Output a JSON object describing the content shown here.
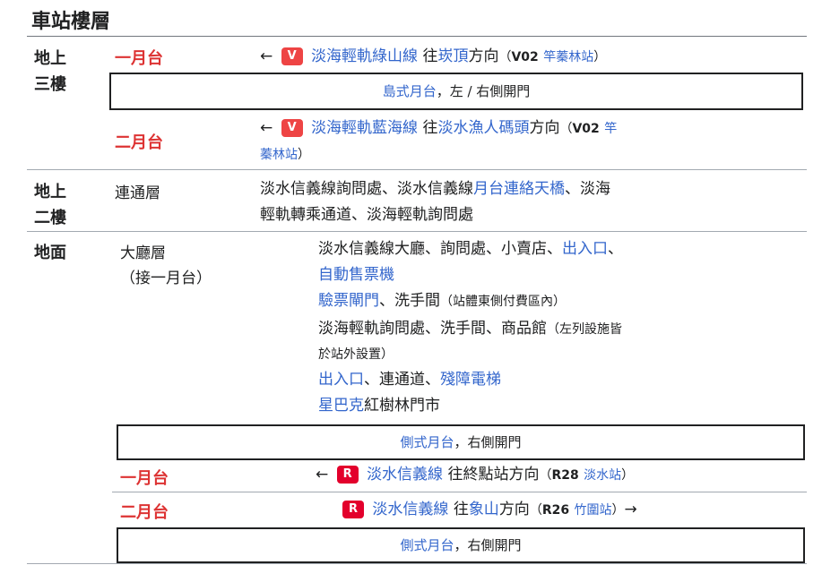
{
  "title": "車站樓層",
  "colors": {
    "lightrail_badge": "#e44444",
    "tamsui_badge": "#e3002c",
    "platform_red": "#dd3333",
    "link_blue": "#3366cc"
  },
  "floors": {
    "b3f": {
      "label_line1": "地上",
      "label_line2": "三樓",
      "platform1": {
        "label": "一月台",
        "arrow": "←",
        "badge": "V",
        "line_name": "淡海輕軌綠山線",
        "wang": "往",
        "dest": "崁頂",
        "dir": "方向",
        "paren_open": "（",
        "code": "V02",
        "station": "竿蓁林站",
        "paren_close": "）"
      },
      "island": {
        "link": "島式月台",
        "rest": "，左 / 右側開門"
      },
      "platform2": {
        "label": "二月台",
        "arrow": "←",
        "badge": "V",
        "line_name": "淡海輕軌藍海線",
        "wang": "往",
        "dest": "淡水漁人碼頭",
        "dir": "方向",
        "paren_open": "（",
        "code": "V02",
        "station_part1": "竿",
        "station_part2": "蓁林站",
        "paren_close": "）"
      }
    },
    "b2f": {
      "label_line1": "地上",
      "label_line2": "二樓",
      "name": "連通層",
      "desc_a": "淡水信義線詢問處、淡水信義線",
      "desc_link": "月台連絡天橋",
      "desc_b": "、淡海",
      "desc_line2": "輕軌轉乘通道、淡海輕軌詢問處"
    },
    "ground": {
      "label": "地面",
      "name": "大廳層",
      "sub": "（接一月台）",
      "row1_a": "淡水信義線大廳、詢問處、小賣店、",
      "row1_link": "出入口",
      "row1_b": "、",
      "row2_link": "自動售票機",
      "row3_link": "驗票閘門",
      "row3_b": "、洗手間",
      "row3_small": "（站體東側付費區內）",
      "row4": "淡海輕軌詢問處、洗手間、商品館",
      "row4_small": "（左列設施皆",
      "row5_small": "於站外設置）",
      "row6_link1": "出入口",
      "row6_b": "、連通道、",
      "row6_link2": "殘障電梯",
      "row7_link": "星巴克",
      "row7_b": "紅樹林門市",
      "side1": {
        "link": "側式月台",
        "rest": "，右側開門"
      },
      "platform1": {
        "label": "一月台",
        "arrow": "←",
        "badge": "R",
        "line_name": "淡水信義線",
        "wang": "往",
        "dest": "終點站方向",
        "paren_open": "（",
        "code": "R28",
        "station": "淡水站",
        "paren_close": "）"
      },
      "platform2": {
        "label": "二月台",
        "badge": "R",
        "line_name": "淡水信義線",
        "wang": "往",
        "dest": "象山",
        "dir": "方向",
        "paren_open": "（",
        "code": "R26",
        "station": "竹圍站",
        "paren_close": "）",
        "arrow": "→"
      },
      "side2": {
        "link": "側式月台",
        "rest": "，右側開門"
      }
    }
  }
}
